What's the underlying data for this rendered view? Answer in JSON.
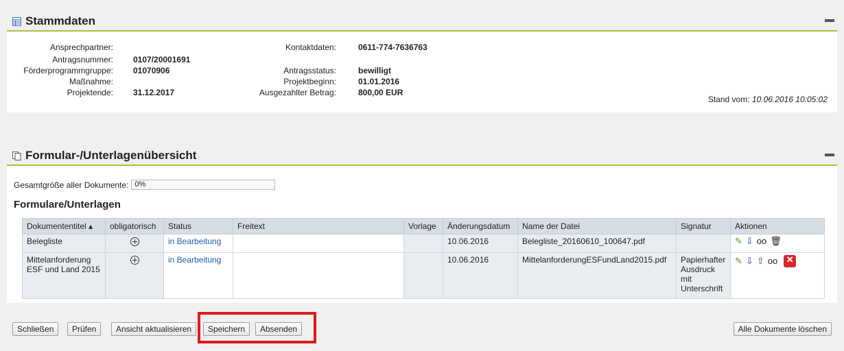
{
  "stammdaten": {
    "title": "Stammdaten",
    "left": [
      {
        "label": "Ansprechpartner:",
        "value": ""
      },
      {
        "label": "Antragsnummer:",
        "value": "0107/20001691"
      },
      {
        "label": "Förderprogrammgruppe:",
        "value": "01070906"
      },
      {
        "label": "Maßnahme:",
        "value": ""
      },
      {
        "label": "Projektende:",
        "value": "31.12.2017"
      }
    ],
    "right": [
      {
        "label": "Kontaktdaten:",
        "value": "0611-774-7636763"
      },
      {
        "label": "Antragsstatus:",
        "value": "bewilligt"
      },
      {
        "label": "Projektbeginn:",
        "value": "01.01.2016"
      },
      {
        "label": "Ausgezahlter Betrag:",
        "value": "800,00 EUR"
      }
    ],
    "stand_label": "Stand vom:",
    "stand_value": "10.06.2016 10:05:02"
  },
  "formular": {
    "title": "Formular-/Unterlagenübersicht",
    "size_label": "Gesamtgröße aller Dokumente:",
    "size_value": "0%",
    "subtitle": "Formulare/Unterlagen",
    "columns": [
      "Dokumententitel",
      "obligatorisch",
      "Status",
      "Freitext",
      "Vorlage",
      "Änderungsdatum",
      "Name der Datei",
      "Signatur",
      "Aktionen"
    ],
    "rows": [
      {
        "title": "Belegliste",
        "status": "in Bearbeitung",
        "freitext": "",
        "vorlage": "",
        "date": "10.06.2016",
        "file": "Belegliste_20160610_100647.pdf",
        "signatur": ""
      },
      {
        "title": "Mittelanforderung ESF und Land 2015",
        "status": "in Bearbeitung",
        "freitext": "",
        "vorlage": "",
        "date": "10.06.2016",
        "file": "MittelanforderungESFundLand2015.pdf",
        "signatur": "Papierhafter Ausdruck mit Unterschrift"
      }
    ]
  },
  "buttons": {
    "close": "Schließen",
    "check": "Prüfen",
    "refresh": "Ansicht aktualisieren",
    "save": "Speichern",
    "send": "Absenden",
    "delete_all": "Alle Dokumente löschen"
  },
  "colors": {
    "accent": "#a6c23c",
    "highlight": "#e01a1a",
    "link": "#1a5ea8"
  },
  "icons": {
    "panel1": "table-icon",
    "panel2": "documents-icon"
  }
}
